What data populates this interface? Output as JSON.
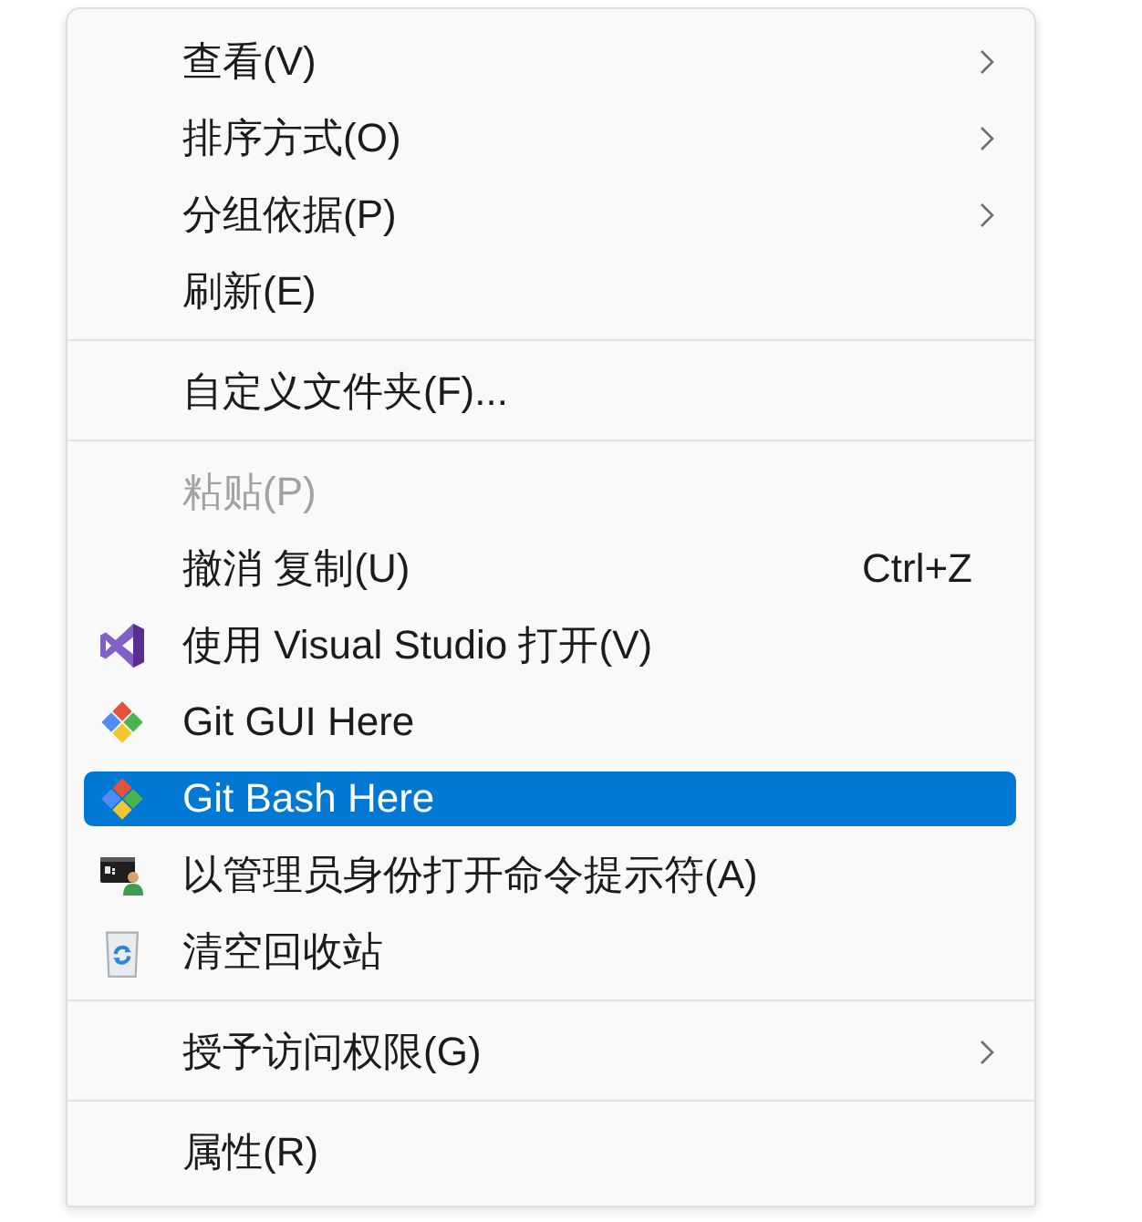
{
  "menu": {
    "sections": [
      {
        "items": [
          {
            "label": "查看(V)",
            "kind": "plain",
            "submenu": true,
            "disabled": false,
            "selected": false
          },
          {
            "label": "排序方式(O)",
            "kind": "plain",
            "submenu": true,
            "disabled": false,
            "selected": false
          },
          {
            "label": "分组依据(P)",
            "kind": "plain",
            "submenu": true,
            "disabled": false,
            "selected": false
          },
          {
            "label": "刷新(E)",
            "kind": "plain",
            "submenu": false,
            "disabled": false,
            "selected": false
          }
        ]
      },
      {
        "items": [
          {
            "label": "自定义文件夹(F)...",
            "kind": "plain",
            "submenu": false,
            "disabled": false,
            "selected": false
          }
        ]
      },
      {
        "items": [
          {
            "label": "粘贴(P)",
            "kind": "plain",
            "submenu": false,
            "disabled": true,
            "selected": false
          },
          {
            "label": "撤消 复制(U)",
            "kind": "plain",
            "submenu": false,
            "disabled": false,
            "selected": false,
            "shortcut": "Ctrl+Z"
          },
          {
            "label": "使用 Visual Studio 打开(V)",
            "kind": "visualstudio",
            "submenu": false,
            "disabled": false,
            "selected": false
          },
          {
            "label": "Git GUI Here",
            "kind": "git",
            "submenu": false,
            "disabled": false,
            "selected": false
          },
          {
            "label": "Git Bash Here",
            "kind": "git",
            "submenu": false,
            "disabled": false,
            "selected": true
          },
          {
            "label": "以管理员身份打开命令提示符(A)",
            "kind": "console",
            "submenu": false,
            "disabled": false,
            "selected": false
          },
          {
            "label": "清空回收站",
            "kind": "recyclebin",
            "submenu": false,
            "disabled": false,
            "selected": false
          }
        ]
      },
      {
        "items": [
          {
            "label": "授予访问权限(G)",
            "kind": "plain",
            "submenu": true,
            "disabled": false,
            "selected": false
          }
        ]
      },
      {
        "items": [
          {
            "label": "属性(R)",
            "kind": "plain",
            "submenu": false,
            "disabled": false,
            "selected": false
          }
        ]
      }
    ]
  }
}
